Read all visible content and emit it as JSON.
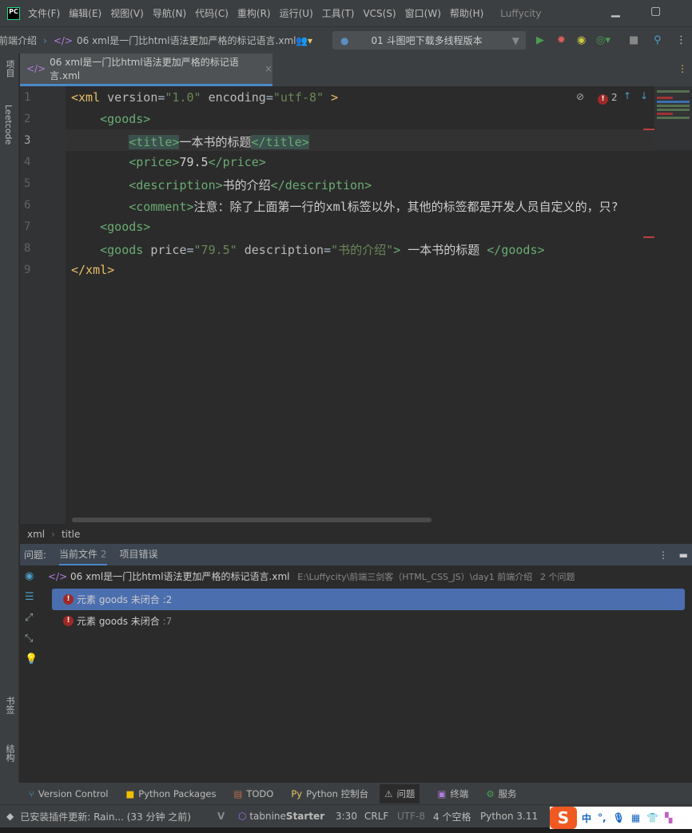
{
  "titlebar": {
    "logo": "PC",
    "menu": [
      "文件(F)",
      "编辑(E)",
      "视图(V)",
      "导航(N)",
      "代码(C)",
      "重构(R)",
      "运行(U)",
      "工具(T)",
      "VCS(S)",
      "窗口(W)",
      "帮助(H)"
    ],
    "project": "Luffycity"
  },
  "navbar": {
    "crumb_parent": "前端介绍",
    "crumb_file": "06 xml是一门比html语法更加严格的标记语言.xml",
    "run_config": "01 斗图吧下载多线程版本"
  },
  "sidebar": {
    "top": [
      "项目",
      "Leetcode"
    ],
    "bottom": [
      "书签",
      "结构"
    ]
  },
  "tab": {
    "label": "06 xml是一门比html语法更加严格的标记语言.xml",
    "close": "×"
  },
  "editor": {
    "error_count": "2",
    "lines": [
      "1",
      "2",
      "3",
      "4",
      "5",
      "6",
      "7",
      "8",
      "9"
    ],
    "code": {
      "l1": {
        "open": "<xml",
        "attr1": "version",
        "v1": "\"1.0\"",
        "attr2": "encoding",
        "v2": "\"utf-8\"",
        "close": ">"
      },
      "l2": "<goods>",
      "l3": {
        "o": "<title>",
        "text": "一本书的标题",
        "c": "</title>"
      },
      "l4": {
        "o": "<price>",
        "text": "79.5",
        "c": "</price>"
      },
      "l5": {
        "o": "<description>",
        "text": "书的介绍",
        "c": "</description>"
      },
      "l6": {
        "o": "<comment>",
        "text": "注意：除了上面第一行的xml标签以外，其他的标签都是开发人员自定义的，只?"
      },
      "l7": "<goods>",
      "l8": {
        "o": "<goods",
        "a1": "price",
        "v1": "\"79.5\"",
        "a2": "description",
        "v2": "\"书的介绍\"",
        "gt": ">",
        "text": " 一本书的标题 ",
        "c": "</goods>"
      },
      "l9": "</xml>"
    }
  },
  "breadcrumb": [
    "xml",
    "title"
  ],
  "problems": {
    "label": "问题:",
    "tabs": [
      {
        "label": "当前文件",
        "count": "2"
      },
      {
        "label": "项目错误"
      }
    ],
    "file": "06 xml是一门比html语法更加严格的标记语言.xml",
    "path": "E:\\Luffycity\\前端三剑客（HTML_CSS_JS）\\day1 前端介绍",
    "count": "2 个问题",
    "items": [
      {
        "text": "元素 goods 未闭合",
        "line": ":2"
      },
      {
        "text": "元素 goods 未闭合",
        "line": ":7"
      }
    ]
  },
  "toolwindows": [
    "Version Control",
    "Python Packages",
    "TODO",
    "Python 控制台",
    "问题",
    "终端",
    "服务"
  ],
  "status": {
    "message": "已安装插件更新: Rain... (33 分钟 之前)",
    "tabnine": "tabnine",
    "tabnine_tier": "Starter",
    "position": "3:30",
    "line_sep": "CRLF",
    "encoding": "UTF-8",
    "indent": "4 个空格",
    "interpreter": "Python 3.11"
  },
  "ime": {
    "logo": "S",
    "mode": "中",
    "punct": "°,"
  }
}
